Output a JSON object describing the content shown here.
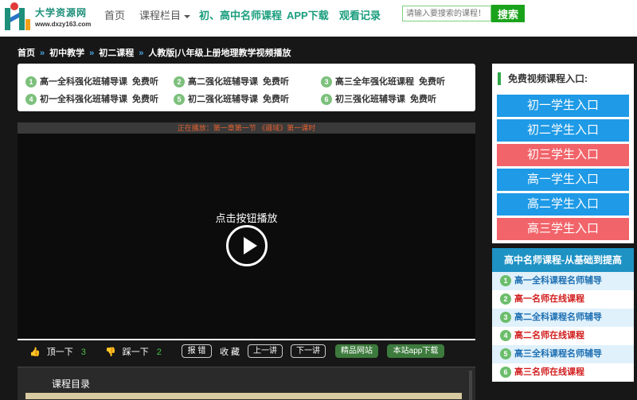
{
  "header": {
    "logo_title": "大学资源网",
    "logo_url": "www.dxzy163.com",
    "nav": [
      "首页",
      "课程栏目",
      "初、高中名师课程",
      "APP下载",
      "观看记录"
    ],
    "search_placeholder": "请输入要搜索的课程！",
    "search_button": "搜索"
  },
  "breadcrumb": [
    "首页",
    "初中教学",
    "初二课程",
    "人教版|八年级上册地理教学视频播放"
  ],
  "free_courses": [
    {
      "num": "1",
      "name": "高一全科强化班辅导课",
      "tag": "免费听"
    },
    {
      "num": "2",
      "name": "高二强化班辅导课",
      "tag": "免费听"
    },
    {
      "num": "3",
      "name": "高三全年强化班课程",
      "tag": "免费听"
    },
    {
      "num": "4",
      "name": "初一全科强化班辅导课",
      "tag": "免费听"
    },
    {
      "num": "5",
      "name": "初二强化班辅导课",
      "tag": "免费听"
    },
    {
      "num": "6",
      "name": "初三强化班辅导课",
      "tag": "免费听"
    }
  ],
  "player": {
    "now_playing": "正在播放：第一章第一节 《疆域》第一课时",
    "click_hint": "点击按钮播放"
  },
  "controls": {
    "like_label": "顶一下",
    "like_count": "3",
    "dislike_label": "踩一下",
    "dislike_count": "2",
    "report": "报 错",
    "favorite": "收 藏",
    "prev": "上一讲",
    "next": "下一讲",
    "site": "精品网站",
    "app": "本站app下载"
  },
  "catalog": {
    "title": "课程目录"
  },
  "free_entry": {
    "title": "免费视频课程入口:",
    "buttons": [
      {
        "label": "初一学生入口",
        "color": "#1e9ae6"
      },
      {
        "label": "初二学生入口",
        "color": "#1e9ae6"
      },
      {
        "label": "初三学生入口",
        "color": "#f1646a"
      },
      {
        "label": "高一学生入口",
        "color": "#1e9ae6"
      },
      {
        "label": "高二学生入口",
        "color": "#1e9ae6"
      },
      {
        "label": "高三学生入口",
        "color": "#f1646a"
      }
    ]
  },
  "teacher": {
    "title": "高中名师课程-从基础到提高",
    "items": [
      {
        "num": "1",
        "label": "高一全科课程名师辅导"
      },
      {
        "num": "2",
        "label": "高一名师在线课程"
      },
      {
        "num": "3",
        "label": "高二全科课程名师辅导"
      },
      {
        "num": "4",
        "label": "高二名师在线课程"
      },
      {
        "num": "5",
        "label": "高三全科课程名师辅导"
      },
      {
        "num": "6",
        "label": "高三名师在线课程"
      }
    ]
  }
}
